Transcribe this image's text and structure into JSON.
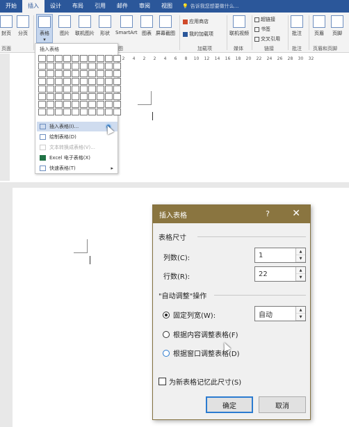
{
  "tabs": [
    "开始",
    "插入",
    "设计",
    "布局",
    "引用",
    "邮件",
    "审阅",
    "视图"
  ],
  "tellme": "告诉我您想要做什么...",
  "ribbon": {
    "cover_page": "封页",
    "blank_page": "分页",
    "table": "表格",
    "pictures": "图片",
    "online_pictures": "联机图片",
    "shapes": "形状",
    "smartart": "SmartArt",
    "chart": "图表",
    "screenshot": "屏幕截图",
    "store": "应用商店",
    "my_addins": "我的加载项",
    "online_video": "联机视频",
    "hyperlink": "超链接",
    "bookmark": "书签",
    "cross_ref": "交叉引用",
    "comment": "批注",
    "header": "页眉",
    "footer": "页脚",
    "groups": {
      "pages": "页面",
      "illustrations": "图",
      "addins": "加载项",
      "media": "媒体",
      "links": "链接",
      "comments": "批注",
      "header_footer": "页眉和页脚"
    }
  },
  "ruler_ticks": [
    "2",
    "4",
    "2",
    "2",
    "4",
    "6",
    "8",
    "10",
    "12",
    "14",
    "16",
    "18",
    "20",
    "22",
    "24",
    "26",
    "28",
    "30",
    "32"
  ],
  "menu": {
    "title": "插入表格",
    "items": [
      "插入表格(I)...",
      "绘制表格(D)",
      "文本转换成表格(V)...",
      "Excel 电子表格(X)",
      "快速表格(T)"
    ]
  },
  "dialog": {
    "title": "插入表格",
    "help": "?",
    "close": "✕",
    "size_section": "表格尺寸",
    "cols_label": "列数(C):",
    "cols_value": "1",
    "rows_label": "行数(R):",
    "rows_value": "22",
    "autofit_section": "\"自动调整\"操作",
    "fixed_label": "固定列宽(W):",
    "fixed_value": "自动",
    "content_label": "根据内容调整表格(F)",
    "window_label": "根据窗口调整表格(D)",
    "remember_label": "为新表格记忆此尺寸(S)",
    "ok": "确定",
    "cancel": "取消"
  }
}
